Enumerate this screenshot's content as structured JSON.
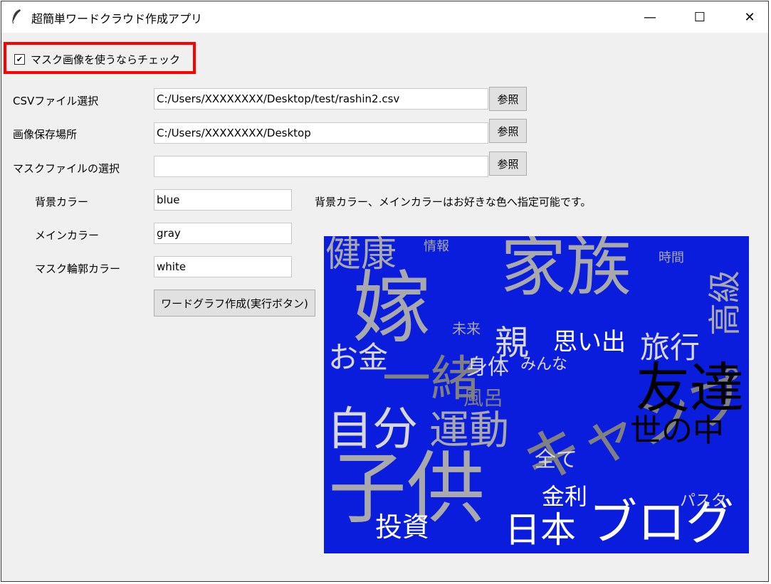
{
  "window": {
    "title": "超簡単ワードクラウド作成アプリ",
    "minimize_glyph": "—",
    "maximize_glyph": "☐",
    "close_glyph": "✕"
  },
  "mask_checkbox": {
    "checked": true,
    "mark": "✔",
    "label": "マスク画像を使うならチェック"
  },
  "form": {
    "csv_label": "CSVファイル選択",
    "csv_value": "C:/Users/XXXXXXXX/Desktop/test/rashin2.csv",
    "save_label": "画像保存場所",
    "save_value": "C:/Users/XXXXXXXX/Desktop",
    "mask_label": "マスクファイルの選択",
    "mask_value": "",
    "browse_label": "参照",
    "bg_color_label": "背景カラー",
    "bg_color_value": "blue",
    "main_color_label": "メインカラー",
    "main_color_value": "gray",
    "mask_outline_label": "マスク輪郭カラー",
    "mask_outline_value": "white",
    "run_button": "ワードグラフ作成(実行ボタン)",
    "note": "背景カラー、メインカラーはお好きな色へ指定可能です。"
  },
  "wordcloud": {
    "background": "#0a1cdc",
    "words": [
      "家族",
      "嫁",
      "子供",
      "キャンプ",
      "友達",
      "世の中",
      "自分",
      "運動",
      "一緒",
      "ブログ",
      "日本",
      "健康",
      "高級",
      "旅行",
      "親",
      "お金",
      "思い出",
      "投資",
      "金利",
      "全て",
      "身体",
      "風呂",
      "パスタ",
      "みんな",
      "未来",
      "時間",
      "情報"
    ]
  },
  "colors": {
    "highlight": "#ff0000",
    "cloud_background": "#0a1cdc",
    "word_gray": "#a9a9a9",
    "word_light": "#d8d8d8",
    "word_white": "#ffffff",
    "word_dark": "#000000"
  }
}
